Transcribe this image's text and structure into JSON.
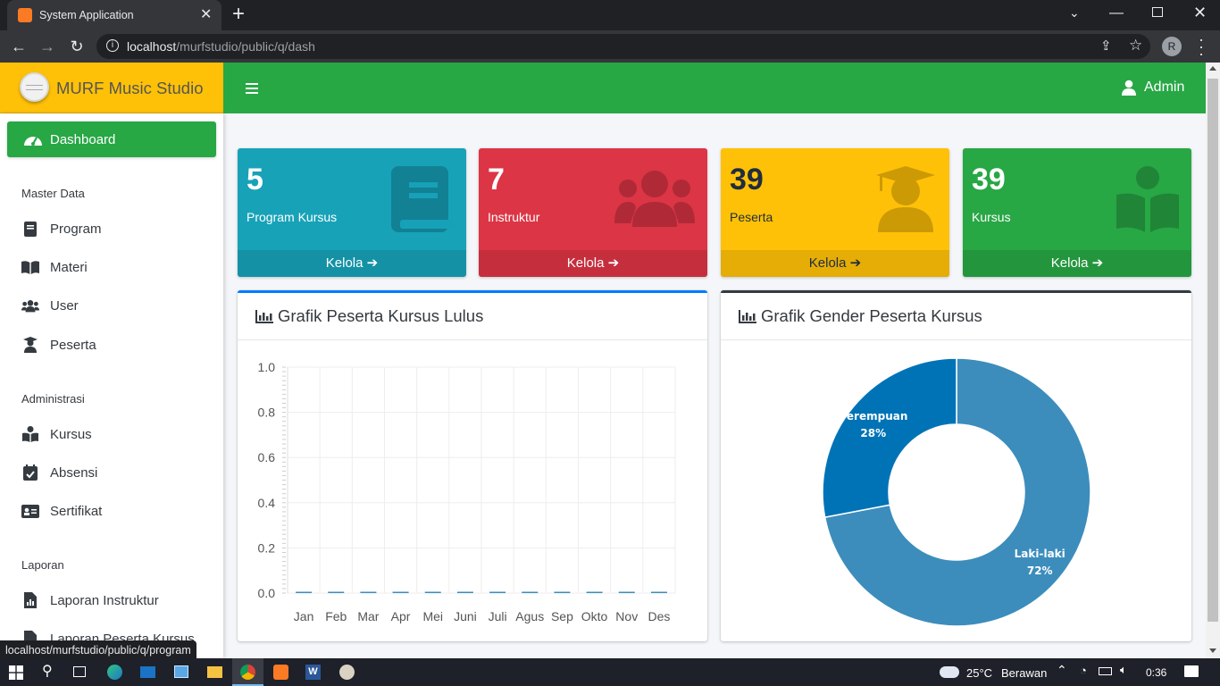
{
  "browser": {
    "tab_title": "System Application",
    "url_host": "localhost",
    "url_path": "/murfstudio/public/q/dash",
    "profile_initial": "R",
    "status_url": "localhost/murfstudio/public/q/program"
  },
  "brand": {
    "name": "MURF Music Studio"
  },
  "header": {
    "user": "Admin"
  },
  "sidebar": {
    "active": {
      "label": "Dashboard"
    },
    "sections": [
      {
        "title": "Master Data",
        "items": [
          {
            "label": "Program"
          },
          {
            "label": "Materi"
          },
          {
            "label": "User"
          },
          {
            "label": "Peserta"
          }
        ]
      },
      {
        "title": "Administrasi",
        "items": [
          {
            "label": "Kursus"
          },
          {
            "label": "Absensi"
          },
          {
            "label": "Sertifikat"
          }
        ]
      },
      {
        "title": "Laporan",
        "items": [
          {
            "label": "Laporan Instruktur"
          },
          {
            "label": "Laporan Peserta Kursus"
          }
        ]
      }
    ]
  },
  "cards": [
    {
      "value": "5",
      "label": "Program Kursus",
      "link": "Kelola",
      "color": "#17a2b8",
      "icon": "book-icon"
    },
    {
      "value": "7",
      "label": "Instruktur",
      "link": "Kelola",
      "color": "#dc3545",
      "icon": "users-icon"
    },
    {
      "value": "39",
      "label": "Peserta",
      "link": "Kelola",
      "color": "#ffc107",
      "icon": "graduate-icon"
    },
    {
      "value": "39",
      "label": "Kursus",
      "link": "Kelola",
      "color": "#28a745",
      "icon": "book-reader-icon"
    }
  ],
  "chart_bar": {
    "title": "Grafik Peserta Kursus Lulus",
    "chart_data": {
      "type": "bar",
      "categories": [
        "Jan",
        "Feb",
        "Mar",
        "Apr",
        "Mei",
        "Juni",
        "Juli",
        "Agus",
        "Sep",
        "Okto",
        "Nov",
        "Des"
      ],
      "values": [
        0,
        0,
        0,
        0,
        0,
        0,
        0,
        0,
        0,
        0,
        0,
        0
      ],
      "ylim": [
        0,
        1.0
      ],
      "yticks": [
        "1.0",
        "0.8",
        "0.6",
        "0.4",
        "0.2",
        "0.0"
      ],
      "color": "#3c8dbc"
    }
  },
  "chart_pie": {
    "title": "Grafik Gender Peserta Kursus",
    "chart_data": {
      "type": "pie",
      "labels": [
        "Laki-laki",
        "Perempuan"
      ],
      "values": [
        72,
        28
      ],
      "value_labels": [
        "72%",
        "28%"
      ],
      "colors": [
        "#3c8dbc",
        "#0073b7"
      ]
    }
  },
  "taskbar": {
    "weather": "25°C",
    "weather_desc": "Berawan",
    "time": "0:36"
  }
}
